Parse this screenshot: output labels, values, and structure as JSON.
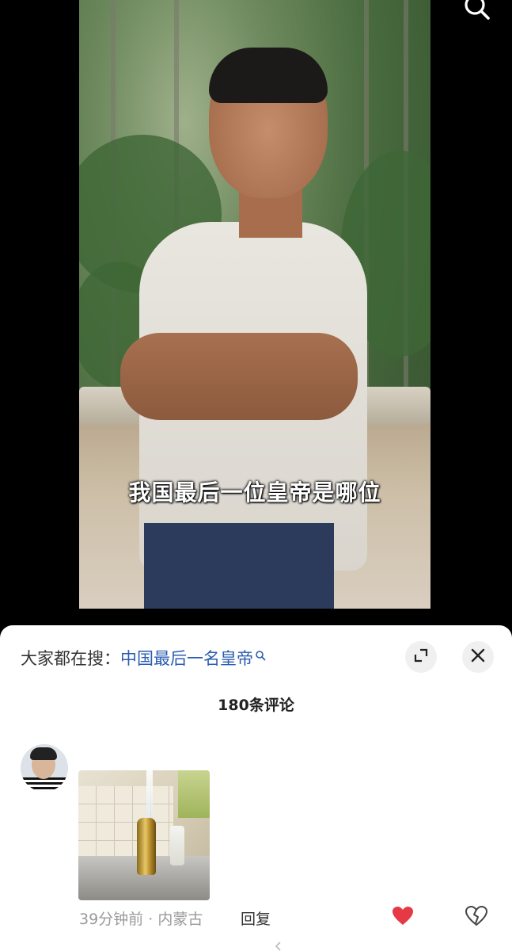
{
  "video": {
    "subtitle": "我国最后一位皇帝是哪位"
  },
  "sheet": {
    "search_prefix": "大家都在搜：",
    "search_query": "中国最后一名皇帝",
    "comment_count": "180条评论"
  },
  "comment": {
    "time": "39分钟前",
    "separator": " · ",
    "location": "内蒙古",
    "reply_label": "回复"
  },
  "icons": {
    "top_search": "search-icon",
    "expand": "expand-icon",
    "close": "close-icon",
    "like": "heart-filled-icon",
    "dislike": "broken-heart-icon"
  },
  "colors": {
    "link_blue": "#2a5db0",
    "like_red": "#e53945"
  }
}
